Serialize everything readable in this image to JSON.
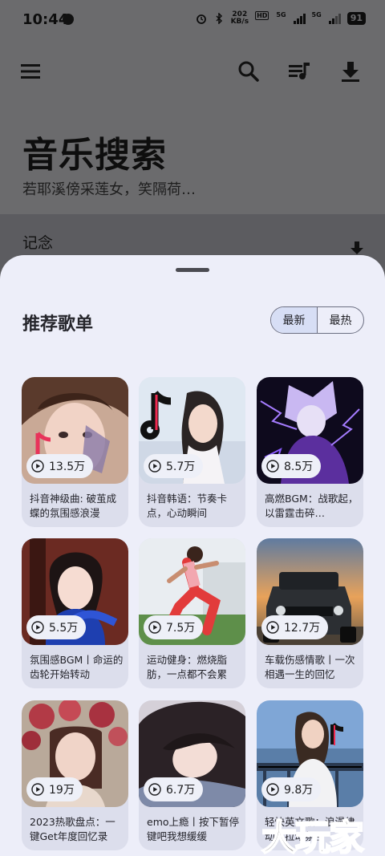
{
  "status_bar": {
    "time": "10:44",
    "speed_value": "202",
    "speed_unit": "KB/s",
    "hd_label": "HD",
    "net_1": "5G",
    "net_2": "5G",
    "battery": "91"
  },
  "header": {
    "title": "音乐搜索",
    "subtitle": "若耶溪傍采莲女，笑隔荷…",
    "section_label": "记念"
  },
  "sheet": {
    "title": "推荐歌单",
    "tabs": [
      {
        "label": "最新",
        "active": true
      },
      {
        "label": "最热",
        "active": false
      }
    ],
    "playlists": [
      {
        "plays": "13.5万",
        "title": "抖音神级曲: 破茧成蝶的氛围感浪漫"
      },
      {
        "plays": "5.7万",
        "title": "抖音韩语：节奏卡点，心动瞬间"
      },
      {
        "plays": "8.5万",
        "title": "高燃BGM：战歌起，以雷霆击碎…"
      },
      {
        "plays": "5.5万",
        "title": "氛围感BGM丨命运的齿轮开始转动"
      },
      {
        "plays": "7.5万",
        "title": "运动健身：燃烧脂肪，一点都不会累"
      },
      {
        "plays": "12.7万",
        "title": "车载伤感情歌丨一次相遇一生的回忆"
      },
      {
        "plays": "19万",
        "title": "2023热歌盘点：一键Get年度回忆录"
      },
      {
        "plays": "6.7万",
        "title": "emo上瘾丨按下暂停键吧我想缓缓"
      },
      {
        "plays": "9.8万",
        "title": "轻快英文歌：浪漫律动，拉动氛围"
      }
    ]
  },
  "watermark": "大玩家",
  "colors": {
    "sheet_bg": "#edeef9",
    "card_bg": "#dcdeec",
    "active_tab": "#d7def5",
    "scrim": "#6b6b6d"
  },
  "icons": [
    "menu-icon",
    "search-icon",
    "playlist-icon",
    "download-icon",
    "play-icon"
  ]
}
